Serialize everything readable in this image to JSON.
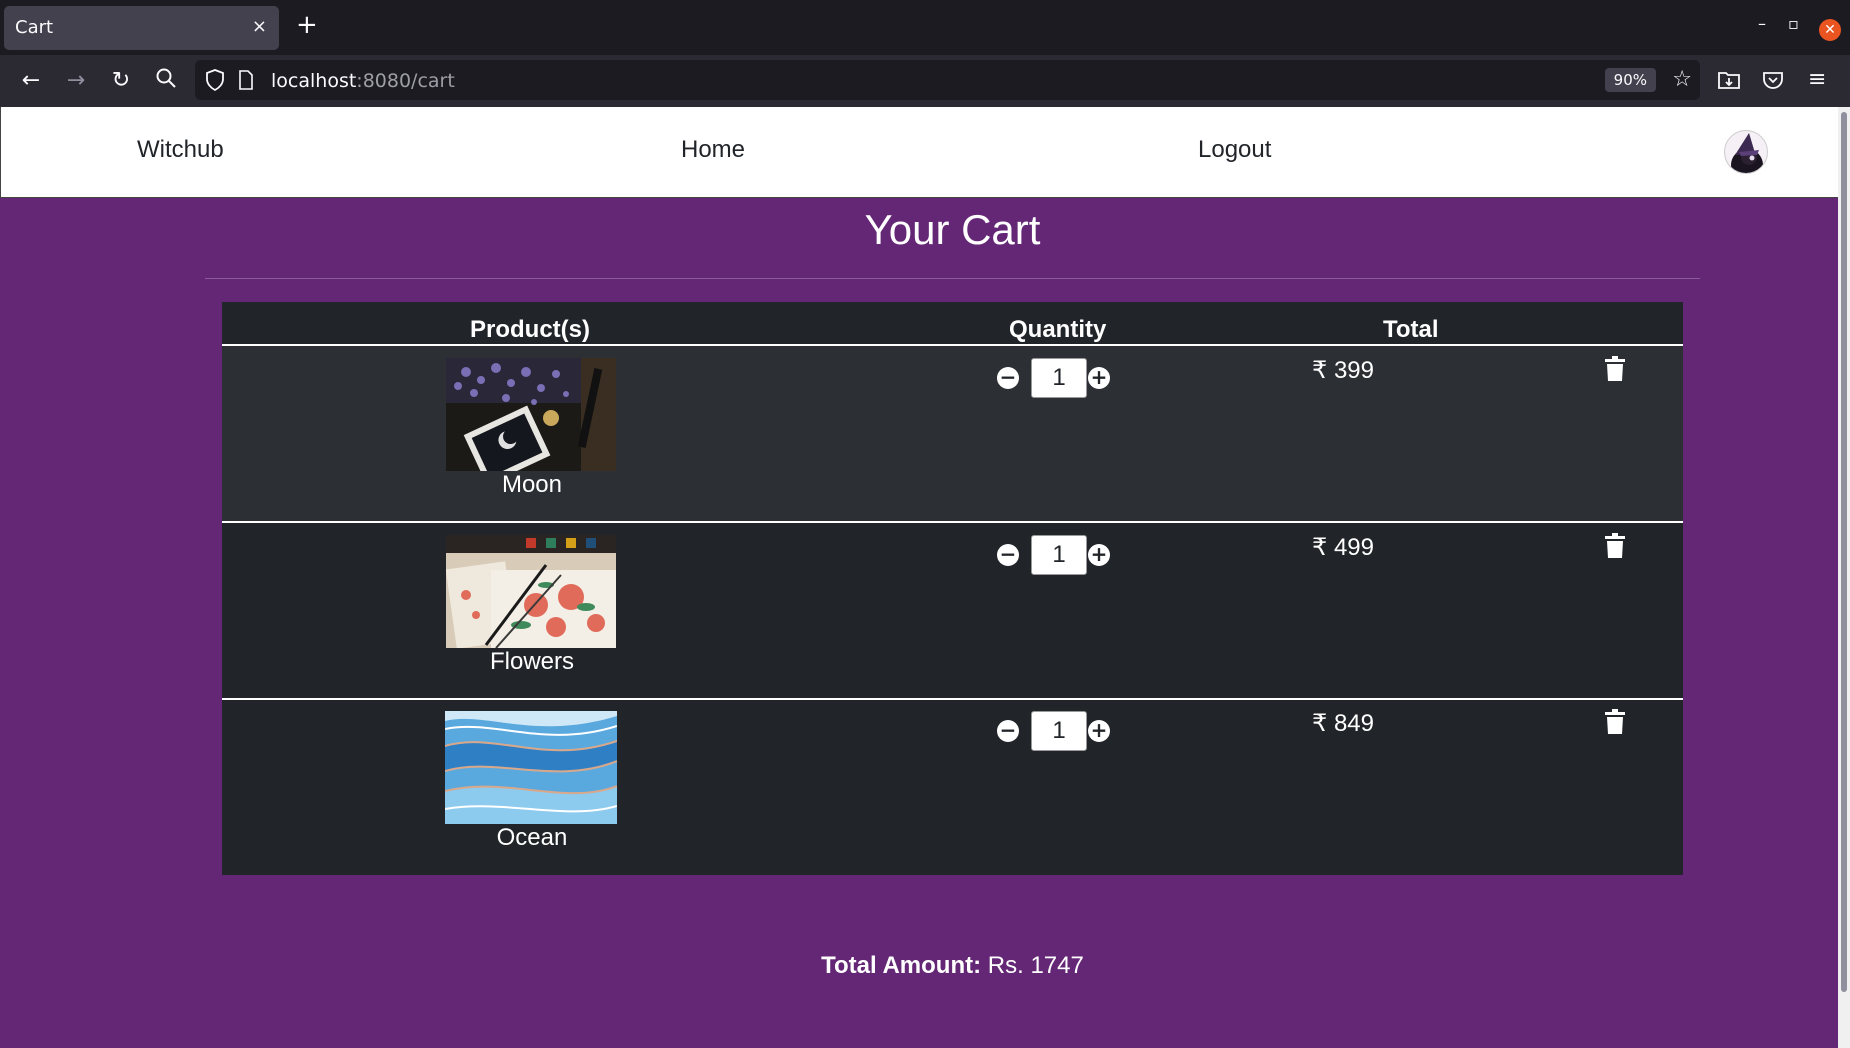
{
  "browser": {
    "tab_title": "Cart",
    "tab_close": "×",
    "new_tab": "+",
    "url_host": "localhost",
    "url_rest": ":8080/cart",
    "zoom": "90%",
    "win_min": "–",
    "win_restore": "▫",
    "win_close": "✕"
  },
  "site": {
    "brand": "Witchub",
    "home": "Home",
    "logout": "Logout"
  },
  "cart": {
    "title": "Your Cart",
    "columns": {
      "products": "Product(s)",
      "quantity": "Quantity",
      "total": "Total"
    },
    "minus": "−",
    "plus": "+",
    "items": [
      {
        "name": "Moon",
        "qty": "1",
        "price": "₹ 399"
      },
      {
        "name": "Flowers",
        "qty": "1",
        "price": "₹ 499"
      },
      {
        "name": "Ocean",
        "qty": "1",
        "price": "₹ 849"
      }
    ],
    "total_label": "Total Amount:",
    "total_value": "Rs. 1747"
  },
  "colors": {
    "page_bg": "#642776",
    "table_bg": "#212529",
    "row_alt": "#2c3034",
    "close_red": "#e95420"
  }
}
